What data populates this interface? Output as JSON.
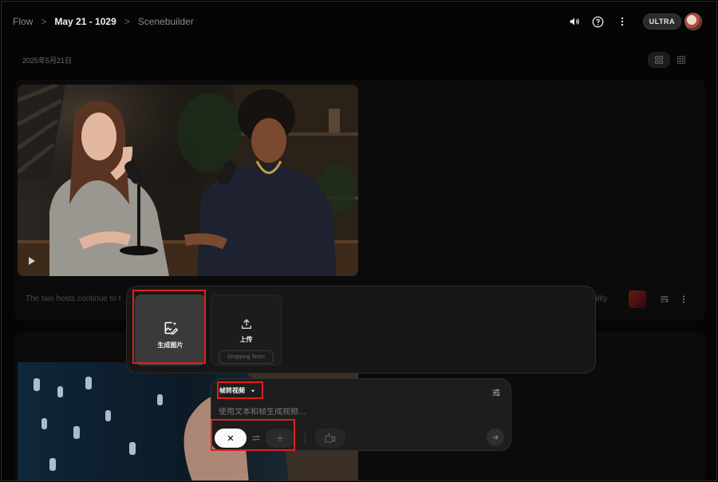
{
  "breadcrumb": [
    "Flow",
    "May 21 - 1029",
    "Scenebuilder"
  ],
  "header": {
    "plan_badge": "ULTRA"
  },
  "icons": {
    "volume": "volume-icon",
    "help": "help-icon",
    "more": "more-vert-icon",
    "grid": "grid-icon",
    "table": "table-grid-icon"
  },
  "timeline": {
    "date": "2025年5月21日"
  },
  "clip1": {
    "caption": "The two hosts continue to t",
    "meta": "uality"
  },
  "create_panel": {
    "generate_image_label": "生成图片",
    "upload_label": "上传",
    "upload_status": "Dropping Soon"
  },
  "composer": {
    "mode_label": "帧转视频",
    "prompt_placeholder": "使用文本和帧生成视频..."
  },
  "colors": {
    "highlight": "#e01f1f",
    "background": "#050505",
    "panel": "#171717"
  }
}
